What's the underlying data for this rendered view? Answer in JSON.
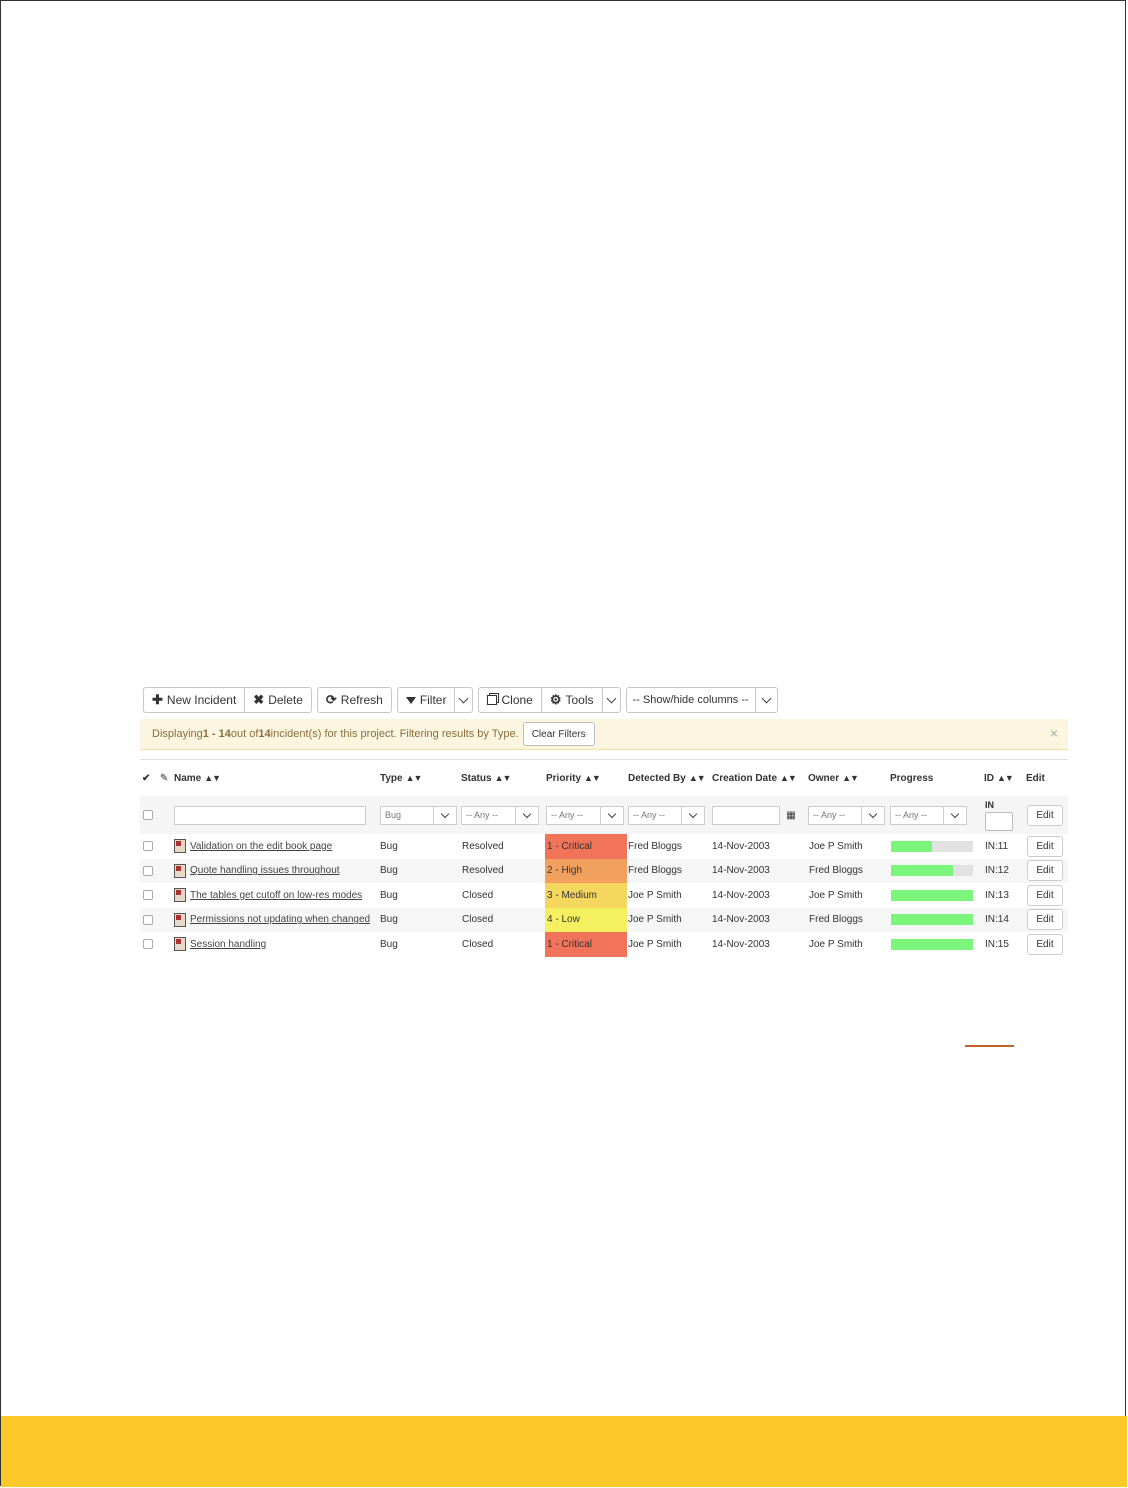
{
  "toolbar": {
    "new_incident": "New Incident",
    "delete": "Delete",
    "refresh": "Refresh",
    "filter": "Filter",
    "clone": "Clone",
    "tools": "Tools",
    "show_hide": "-- Show/hide columns --"
  },
  "alert": {
    "prefix": "Displaying ",
    "range": "1 - 14",
    "middle": " out of ",
    "total": "14",
    "suffix": " incident(s) for this project. Filtering results by Type.",
    "clear_filters": "Clear Filters",
    "close": "×"
  },
  "headers": {
    "check": "✔",
    "attach": "✎",
    "name": "Name",
    "type": "Type",
    "status": "Status",
    "priority": "Priority",
    "detected_by": "Detected By",
    "creation_date": "Creation Date",
    "owner": "Owner",
    "progress": "Progress",
    "id": "ID",
    "edit": "Edit",
    "sort": "▲▼"
  },
  "filters": {
    "name": "",
    "type": "Bug",
    "status": "-- Any --",
    "priority": "-- Any --",
    "detected_by": "-- Any --",
    "creation_date": "",
    "owner": "-- Any --",
    "progress": "-- Any --",
    "id_label": "IN",
    "edit": "Edit"
  },
  "rows": [
    {
      "name": "Validation on the edit book page",
      "type": "Bug",
      "status": "Resolved",
      "priority": "1 - Critical",
      "priority_color": "#f0735a",
      "detected_by": "Fred Bloggs",
      "date": "14-Nov-2003",
      "owner": "Joe P Smith",
      "progress": 0.5,
      "id": "IN:11",
      "edit": "Edit"
    },
    {
      "name": "Quote handling issues throughout",
      "type": "Bug",
      "status": "Resolved",
      "priority": "2 - High",
      "priority_color": "#f2a05e",
      "detected_by": "Fred Bloggs",
      "date": "14-Nov-2003",
      "owner": "Fred Bloggs",
      "progress": 0.75,
      "id": "IN:12",
      "edit": "Edit"
    },
    {
      "name": "The tables get cutoff on low-res modes",
      "type": "Bug",
      "status": "Closed",
      "priority": "3 - Medium",
      "priority_color": "#f5d65e",
      "detected_by": "Joe P Smith",
      "date": "14-Nov-2003",
      "owner": "Joe P Smith",
      "progress": 1.0,
      "id": "IN:13",
      "edit": "Edit"
    },
    {
      "name": "Permissions not updating when changed",
      "type": "Bug",
      "status": "Closed",
      "priority": "4 - Low",
      "priority_color": "#f4f060",
      "detected_by": "Joe P Smith",
      "date": "14-Nov-2003",
      "owner": "Fred Bloggs",
      "progress": 1.0,
      "id": "IN:14",
      "edit": "Edit"
    },
    {
      "name": "Session handling",
      "type": "Bug",
      "status": "Closed",
      "priority": "1 - Critical",
      "priority_color": "#f0735a",
      "detected_by": "Joe P Smith",
      "date": "14-Nov-2003",
      "owner": "Joe P Smith",
      "progress": 1.0,
      "id": "IN:15",
      "edit": "Edit"
    }
  ],
  "colors": {
    "footer": "#fcc928",
    "alert_bg": "#fcf6e1",
    "progress_fill": "#7cf57c",
    "progress_track": "#e2e2e2",
    "header_rule": "#f0a24a"
  }
}
